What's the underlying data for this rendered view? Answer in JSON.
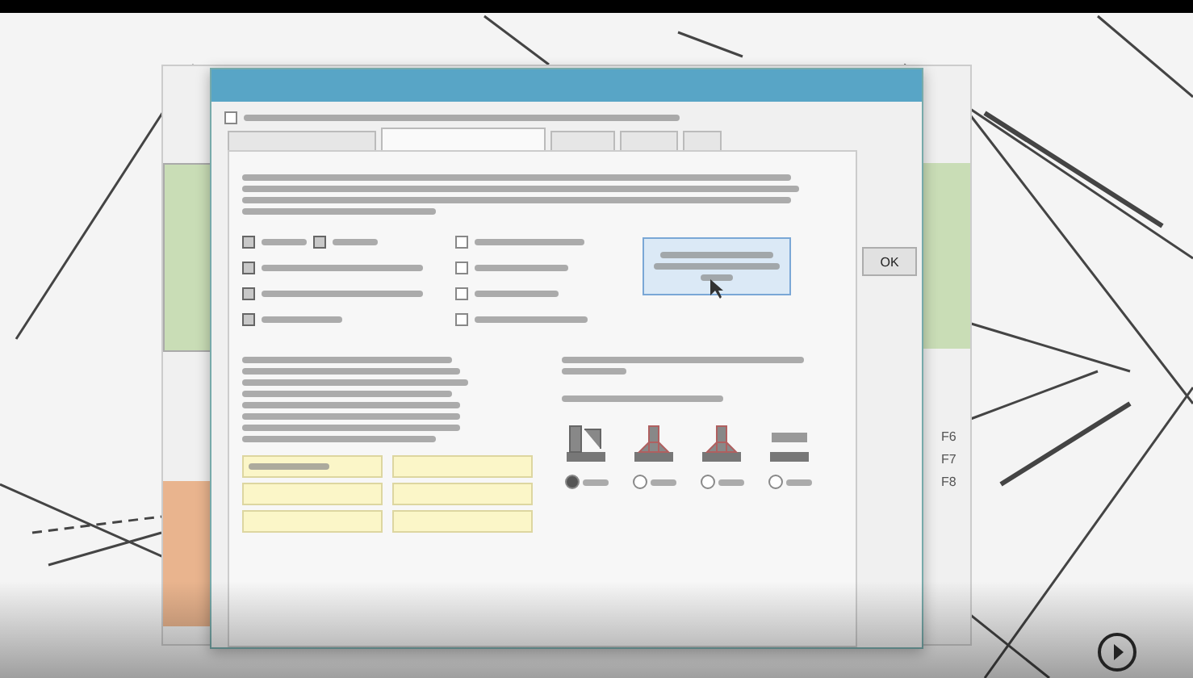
{
  "background_window": {
    "function_keys": [
      "F6",
      "F7",
      "F8"
    ]
  },
  "dialog": {
    "top_checkbox": {
      "checked": false
    },
    "tabs": [
      {
        "selected": false
      },
      {
        "selected": true
      },
      {
        "selected": false
      },
      {
        "selected": false
      },
      {
        "selected": false
      }
    ],
    "checkboxes": [
      {
        "checked": true
      },
      {
        "checked": true
      },
      {
        "checked": true
      },
      {
        "checked": true
      },
      {
        "checked": true
      },
      {
        "checked": false
      },
      {
        "checked": false
      },
      {
        "checked": false
      },
      {
        "checked": false
      }
    ],
    "fields": [
      {
        "has_text": true
      },
      {
        "has_text": false
      },
      {
        "has_text": false
      },
      {
        "has_text": false
      },
      {
        "has_text": false
      },
      {
        "has_text": false
      }
    ],
    "weld_options": [
      {
        "selected": true
      },
      {
        "selected": false
      },
      {
        "selected": false
      },
      {
        "selected": false
      }
    ],
    "ok_button": {
      "label": "OK"
    }
  }
}
